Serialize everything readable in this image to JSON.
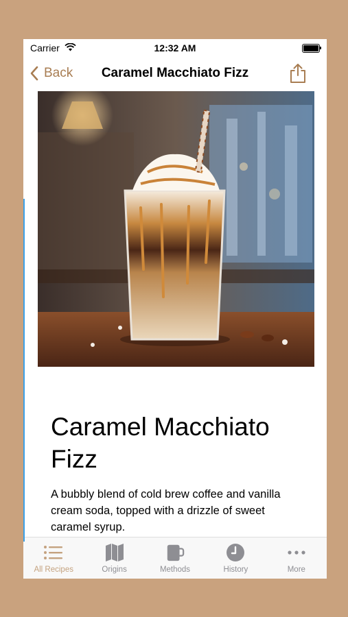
{
  "status_bar": {
    "carrier": "Carrier",
    "time": "12:32 AM"
  },
  "nav": {
    "back_label": "Back",
    "title": "Caramel Macchiato Fizz"
  },
  "recipe": {
    "title": "Caramel Macchiato Fizz",
    "description": "A bubbly blend of cold brew coffee and vanilla cream soda, topped with a drizzle of sweet caramel syrup."
  },
  "tabs": [
    {
      "label": "All Recipes",
      "icon": "list-icon",
      "active": true
    },
    {
      "label": "Origins",
      "icon": "map-icon",
      "active": false
    },
    {
      "label": "Methods",
      "icon": "mug-icon",
      "active": false
    },
    {
      "label": "History",
      "icon": "clock-icon",
      "active": false
    },
    {
      "label": "More",
      "icon": "ellipsis-icon",
      "active": false
    }
  ],
  "colors": {
    "accent": "#a87d52",
    "tab_active": "#c4a27f",
    "tab_inactive": "#8e8e93",
    "background": "#c9a27e"
  }
}
